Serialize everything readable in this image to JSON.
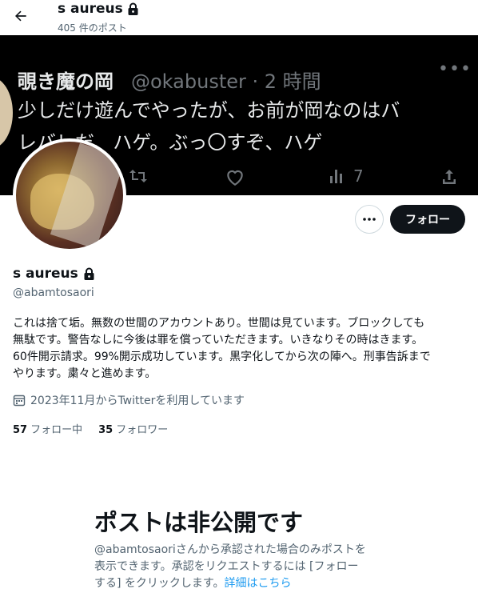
{
  "header": {
    "title": "s aureus",
    "post_count": "405 件のポスト"
  },
  "banner": {
    "name": "覗き魔の岡",
    "handle_time": "@okabuster · 2 時間",
    "line1": "少しだけ遊んでやったが、お前が岡なのはバ",
    "line2": "レバレだ、ハゲ。ぶっ〇すぞ、ハゲ",
    "views": "7"
  },
  "actions": {
    "follow_label": "フォロー"
  },
  "profile": {
    "display_name": "s aureus",
    "handle": "@abamtosaori",
    "bio_lines": [
      "これは捨て垢。無数の世間のアカウントあり。世間は見ています。ブロックしても",
      "無駄です。警告なしに今後は罪を償っていただきます。いきなりその時はきます。",
      "60件開示請求。99%開示成功しています。黒字化してから次の陣へ。刑事告訴まで",
      "やります。粛々と進めます。"
    ],
    "joined": "2023年11月からTwitterを利用しています",
    "following_count": "57",
    "following_label": "フォロー中",
    "followers_count": "35",
    "followers_label": "フォロワー"
  },
  "private": {
    "title": "ポストは非公開です",
    "desc_line1": "@abamtosaoriさんから承認された場合のみポストを",
    "desc_line2": "表示できます。承認をリクエストするには [フォロー",
    "desc_line3_a": "する] をクリックします。",
    "desc_link": "詳細はこちら"
  },
  "colors": {
    "text": "#0f1419",
    "secondary": "#536471",
    "link": "#1d9bf0",
    "button": "#0f1419"
  },
  "icons": [
    "back-arrow-icon",
    "lock-icon",
    "more-icon",
    "calendar-icon",
    "retweet-icon",
    "like-icon",
    "views-icon",
    "share-icon"
  ]
}
